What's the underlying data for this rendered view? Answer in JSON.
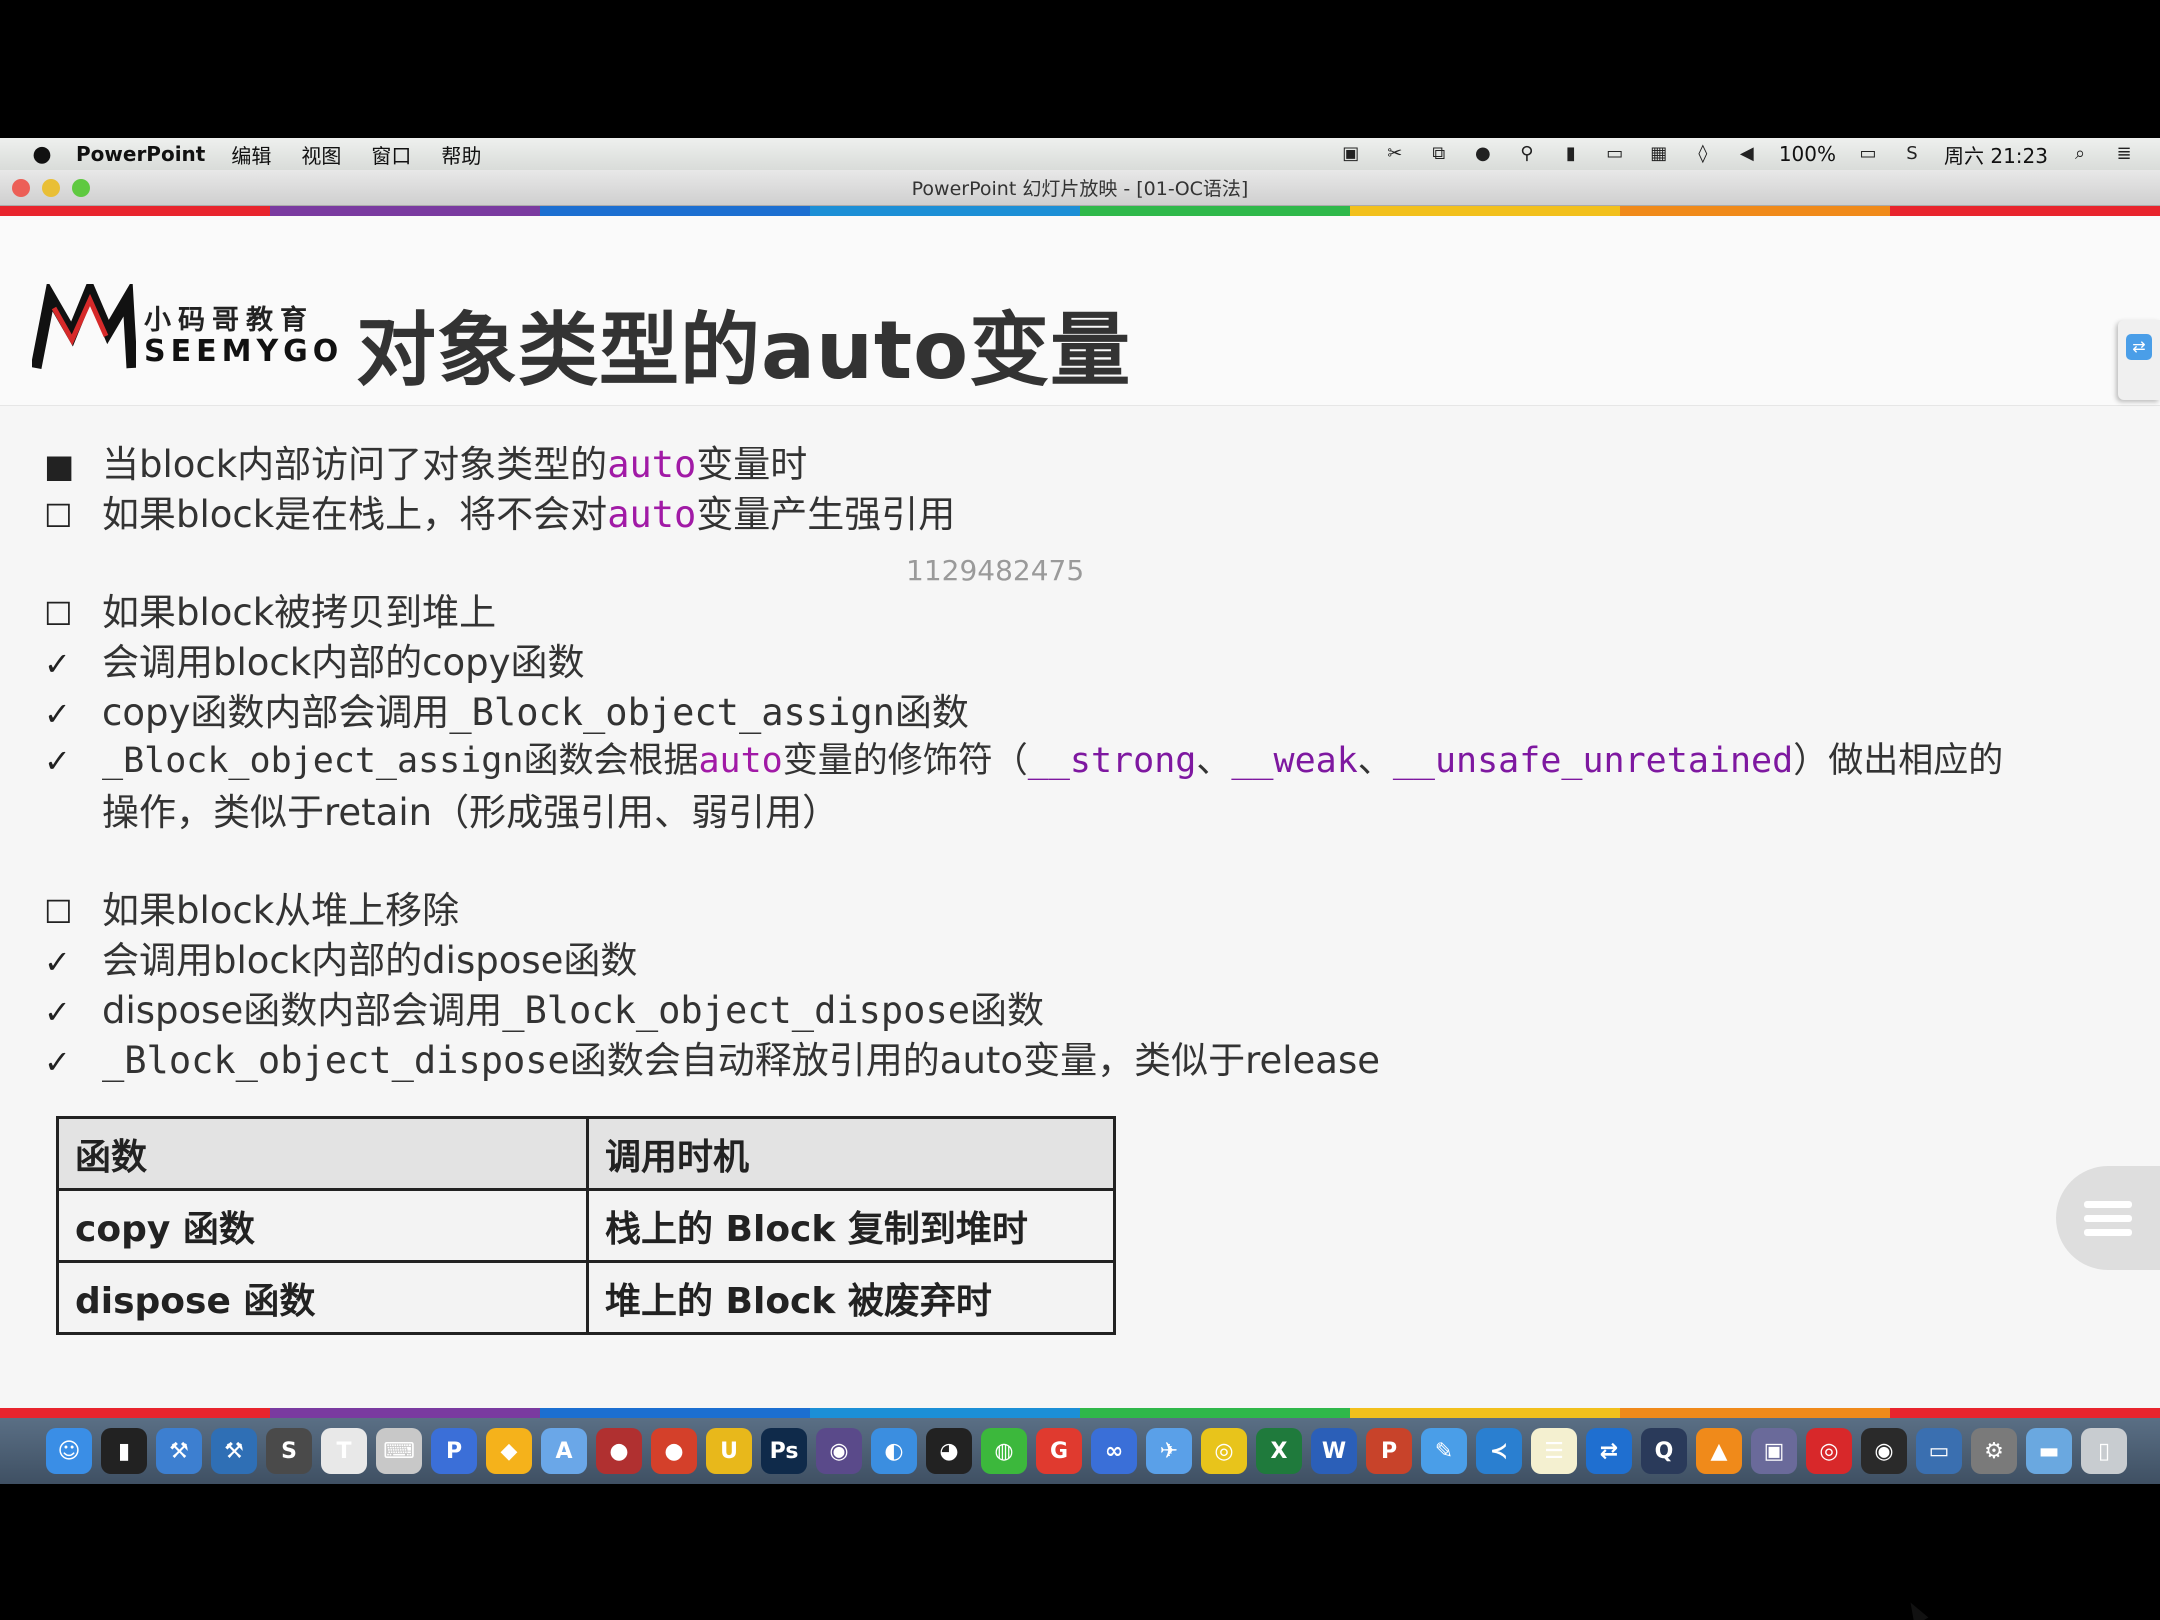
{
  "menubar": {
    "app_name": "PowerPoint",
    "menus": [
      "编辑",
      "视图",
      "窗口",
      "帮助"
    ],
    "battery": "100%",
    "datetime": "周六 21:23",
    "status_icons": [
      "screen-record-icon",
      "scissors-icon",
      "crop-icon",
      "qq-penguin-icon",
      "pin-icon",
      "mouse-icon",
      "display-icon",
      "input-method-icon",
      "shield-icon",
      "volume-icon",
      "battery-icon",
      "sync-icon",
      "search-icon",
      "list-icon"
    ]
  },
  "window": {
    "title": "PowerPoint 幻灯片放映 - [01-OC语法]"
  },
  "rainbow_colors": [
    "#e8242d",
    "#7a3aa0",
    "#1c6fd1",
    "#1c8fd6",
    "#2fb84a",
    "#f2c01c",
    "#f08a1a",
    "#e8242d"
  ],
  "slide": {
    "logo_cn": "小码哥教育",
    "logo_en": "SEEMYGO",
    "title": "对象类型的auto变量",
    "watermark": "1129482475",
    "lines": {
      "l1": {
        "marker": "■",
        "a": "当block内部访问了对象类型的",
        "b": "auto",
        "c": "变量时"
      },
      "l2": {
        "marker": "☐",
        "a": "如果block是在栈上，将不会对",
        "b": "auto",
        "c": "变量产生强引用"
      },
      "l3": {
        "marker": "☐",
        "a": "如果block被拷贝到堆上"
      },
      "l4": {
        "marker": "✓",
        "a": "会调用block内部的copy函数"
      },
      "l5": {
        "marker": "✓",
        "a": "copy函数内部会调用",
        "b": "_Block_object_assign",
        "c": "函数"
      },
      "l6": {
        "marker": "✓",
        "a": "_Block_object_assign",
        "b": "函数会根据",
        "c": "auto",
        "d": "变量的修饰符（",
        "e": "__strong",
        "f": "、",
        "g": "__weak",
        "h": "、",
        "i": "__unsafe_unretained",
        "j": "）做出相应的"
      },
      "l6b": {
        "a": "操作，类似于retain（形成强引用、弱引用）"
      },
      "l7": {
        "marker": "☐",
        "a": "如果block从堆上移除"
      },
      "l8": {
        "marker": "✓",
        "a": "会调用block内部的dispose函数"
      },
      "l9": {
        "marker": "✓",
        "a": "dispose函数内部会调用",
        "b": "_Block_object_dispose",
        "c": "函数"
      },
      "l10": {
        "marker": "✓",
        "a": "_Block_object_dispose",
        "b": "函数会自动释放引用的auto变量，类似于release"
      }
    },
    "table": {
      "headers": [
        "函数",
        "调用时机"
      ],
      "rows": [
        [
          "copy 函数",
          "栈上的 Block 复制到堆时"
        ],
        [
          "dispose 函数",
          "堆上的 Block 被废弃时"
        ]
      ]
    }
  },
  "dock": {
    "apps": [
      {
        "name": "finder-icon",
        "glyph": "☺",
        "color": "#3a8ee6"
      },
      {
        "name": "terminal-icon",
        "glyph": "▮",
        "color": "#222222"
      },
      {
        "name": "xcode-icon",
        "glyph": "⚒",
        "color": "#3d7fd0"
      },
      {
        "name": "xcode-beta-icon",
        "glyph": "⚒",
        "color": "#2f6fb5"
      },
      {
        "name": "sublime-icon",
        "glyph": "S",
        "color": "#4a4a4a"
      },
      {
        "name": "typora-icon",
        "glyph": "T",
        "color": "#e8e8e8"
      },
      {
        "name": "keyboard-icon",
        "glyph": "⌨",
        "color": "#c8c8c8"
      },
      {
        "name": "paw-icon",
        "glyph": "P",
        "color": "#3b6fd8"
      },
      {
        "name": "sketch-icon",
        "glyph": "◆",
        "color": "#f5b21b"
      },
      {
        "name": "app-store-icon",
        "glyph": "A",
        "color": "#6aa7e8"
      },
      {
        "name": "photo-booth-icon",
        "glyph": "●",
        "color": "#b03030"
      },
      {
        "name": "tomato-icon",
        "glyph": "●",
        "color": "#d4402a"
      },
      {
        "name": "ue-icon",
        "glyph": "U",
        "color": "#e8b81b"
      },
      {
        "name": "photoshop-icon",
        "glyph": "Ps",
        "color": "#0f2a4a"
      },
      {
        "name": "github-icon",
        "glyph": "◉",
        "color": "#5a4a8a"
      },
      {
        "name": "browser-icon",
        "glyph": "◐",
        "color": "#3b8ee0"
      },
      {
        "name": "qq-icon",
        "glyph": "◕",
        "color": "#222222"
      },
      {
        "name": "wechat-icon",
        "glyph": "◍",
        "color": "#3cb83c"
      },
      {
        "name": "git-icon",
        "glyph": "G",
        "color": "#e03a2f"
      },
      {
        "name": "baidu-icon",
        "glyph": "∞",
        "color": "#3a6fd8"
      },
      {
        "name": "mail-icon",
        "glyph": "✈",
        "color": "#5aa0e8"
      },
      {
        "name": "chrome-icon",
        "glyph": "◎",
        "color": "#e8c41b"
      },
      {
        "name": "excel-icon",
        "glyph": "X",
        "color": "#1f7a3c"
      },
      {
        "name": "word-icon",
        "glyph": "W",
        "color": "#2b5fb8"
      },
      {
        "name": "powerpoint-icon",
        "glyph": "P",
        "color": "#c8432a"
      },
      {
        "name": "pencil-icon",
        "glyph": "✎",
        "color": "#4a9ee8"
      },
      {
        "name": "vscode-icon",
        "glyph": "≺",
        "color": "#2a7fd0"
      },
      {
        "name": "notes-icon",
        "glyph": "☰",
        "color": "#f4f0d0"
      },
      {
        "name": "teamviewer-icon",
        "glyph": "⇄",
        "color": "#1f6fd0"
      },
      {
        "name": "quicktime-icon",
        "glyph": "Q",
        "color": "#2a3a5a"
      },
      {
        "name": "vlc-icon",
        "glyph": "▲",
        "color": "#f08a1a"
      },
      {
        "name": "video-icon",
        "glyph": "▣",
        "color": "#6a6a9a"
      },
      {
        "name": "netease-music-icon",
        "glyph": "◎",
        "color": "#d8282a"
      },
      {
        "name": "dvd-icon",
        "glyph": "◉",
        "color": "#2a2a2a"
      },
      {
        "name": "screen-icon",
        "glyph": "▭",
        "color": "#3a6fb0"
      },
      {
        "name": "system-prefs-icon",
        "glyph": "⚙",
        "color": "#7a7a7a"
      },
      {
        "name": "folder-icon",
        "glyph": "▬",
        "color": "#6aa8e0"
      },
      {
        "name": "trash-icon",
        "glyph": "▯",
        "color": "#c8ccd0"
      }
    ]
  }
}
